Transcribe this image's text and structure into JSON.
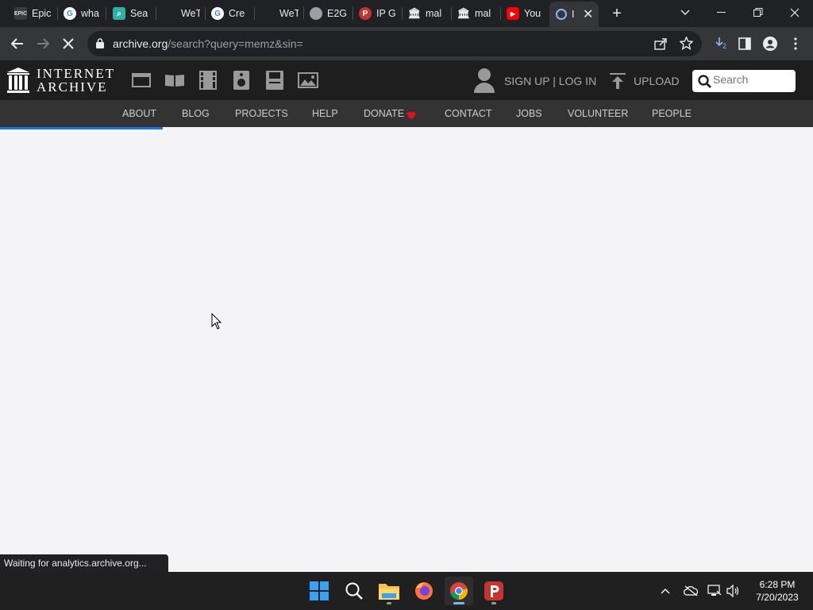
{
  "browser": {
    "tabs": [
      {
        "title": "Epic",
        "icon": "epic-icon"
      },
      {
        "title": "wha",
        "icon": "google-icon"
      },
      {
        "title": "Sea",
        "icon": "search-app-icon"
      },
      {
        "title": "WeT",
        "icon": "wetransfer-icon"
      },
      {
        "title": "Cre",
        "icon": "google-icon"
      },
      {
        "title": "WeT",
        "icon": "wetransfer-icon"
      },
      {
        "title": "E2G",
        "icon": "globe-icon"
      },
      {
        "title": "IP G",
        "icon": "psiphon-icon"
      },
      {
        "title": "mal",
        "icon": "archive-icon"
      },
      {
        "title": "mal",
        "icon": "archive-icon"
      },
      {
        "title": "You",
        "icon": "youtube-icon"
      },
      {
        "title": "I",
        "icon": "loading-icon"
      }
    ],
    "url_host": "archive.org",
    "url_path": "/search?query=memz&sin=",
    "download_badge": "2",
    "status_text": "Waiting for analytics.archive.org...",
    "load_progress": 0.2
  },
  "ia": {
    "logo_line1": "INTERNET",
    "logo_line2": "ARCHIVE",
    "signup_text": "SIGN UP | LOG IN",
    "upload_text": "UPLOAD",
    "search_placeholder": "Search",
    "nav": [
      "ABOUT",
      "BLOG",
      "PROJECTS",
      "HELP",
      "DONATE",
      "CONTACT",
      "JOBS",
      "VOLUNTEER",
      "PEOPLE"
    ],
    "donate_heart_color": "#e0141e"
  },
  "taskbar": {
    "time": "6:28 PM",
    "date": "7/20/2023"
  }
}
